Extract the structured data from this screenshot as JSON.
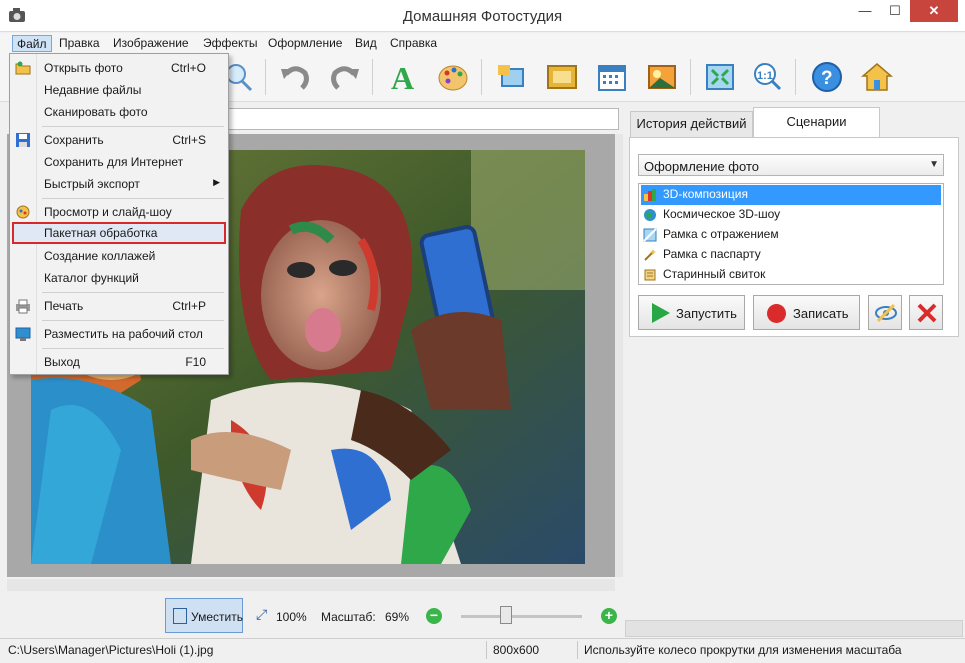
{
  "window": {
    "title": "Домашняя Фотостудия",
    "minimize": "—",
    "maximize": "☐",
    "close": "✕"
  },
  "menubar": [
    "Файл",
    "Правка",
    "Изображение",
    "Эффекты",
    "Оформление",
    "Вид",
    "Справка"
  ],
  "file_menu": {
    "items": [
      {
        "label": "Открыть фото",
        "shortcut": "Ctrl+O",
        "icon": "folder-icon"
      },
      {
        "label": "Недавние файлы",
        "shortcut": "",
        "icon": ""
      },
      {
        "label": "Сканировать фото",
        "shortcut": "",
        "icon": ""
      },
      {
        "label": "Сохранить",
        "shortcut": "Ctrl+S",
        "icon": "floppy-icon"
      },
      {
        "label": "Сохранить для Интернет",
        "shortcut": "",
        "icon": ""
      },
      {
        "label": "Быстрый экспорт",
        "shortcut": "",
        "icon": "",
        "submenu": "▶"
      },
      {
        "label": "Просмотр и слайд-шоу",
        "shortcut": "",
        "icon": "slideshow-icon"
      },
      {
        "label": "Пакетная обработка",
        "shortcut": "",
        "icon": "",
        "highlighted": true
      },
      {
        "label": "Создание коллажей",
        "shortcut": "",
        "icon": ""
      },
      {
        "label": "Каталог функций",
        "shortcut": "",
        "icon": ""
      },
      {
        "label": "Печать",
        "shortcut": "Ctrl+P",
        "icon": "printer-icon"
      },
      {
        "label": "Разместить на рабочий стол",
        "shortcut": "",
        "icon": "desktop-icon"
      },
      {
        "label": "Выход",
        "shortcut": "F10",
        "icon": ""
      }
    ]
  },
  "toolbar_icons": [
    "zoom-icon",
    "undo-icon",
    "redo-icon",
    "text-icon",
    "palette-icon",
    "frame-icon",
    "picture-frame-icon",
    "calendar-icon",
    "postcard-icon",
    "fit-window-icon",
    "actual-size-icon",
    "help-icon",
    "home-icon"
  ],
  "right_panel": {
    "tabs": [
      "История действий",
      "Сценарии"
    ],
    "active_tab": "Сценарии",
    "category": "Оформление фото",
    "scenarios": [
      {
        "label": "3D-композиция",
        "selected": true,
        "icon": "3d-icon"
      },
      {
        "label": "Космическое 3D-шоу",
        "selected": false,
        "icon": "globe-icon"
      },
      {
        "label": "Рамка с отражением",
        "selected": false,
        "icon": "reflection-icon"
      },
      {
        "label": "Рамка с паспарту",
        "selected": false,
        "icon": "wand-icon"
      },
      {
        "label": "Старинный свиток",
        "selected": false,
        "icon": "scroll-icon"
      }
    ],
    "run_label": "Запустить",
    "record_label": "Записать"
  },
  "zoom": {
    "fit_label": "Уместить",
    "actual_label": "100%",
    "scale_label": "Масштаб:",
    "scale_value": "69%",
    "slider_level_percent": 69
  },
  "status": {
    "path": "C:\\Users\\Manager\\Pictures\\Holi (1).jpg",
    "dimensions": "800x600",
    "hint": "Используйте колесо прокрутки для изменения масштаба"
  },
  "colors": {
    "accent": "#3399ff",
    "highlight_border": "#d62a2a",
    "close_button": "#c7453d",
    "run_green": "#27a844",
    "record_red": "#d92b2b"
  }
}
